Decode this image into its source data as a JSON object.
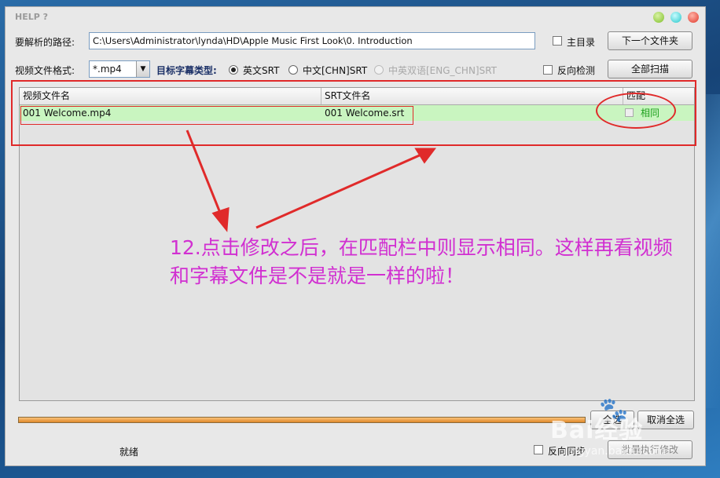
{
  "window": {
    "title": "HELP ?"
  },
  "path": {
    "label": "要解析的路径:",
    "value": "C:\\Users\\Administrator\\lynda\\HD\\Apple Music First Look\\0. Introduction"
  },
  "main_dir": {
    "label": "主目录"
  },
  "next_folder_button": "下一个文件夹",
  "format": {
    "label": "视频文件格式:",
    "value": "*.mp4"
  },
  "subtitle_type": {
    "label": "目标字幕类型:",
    "options": [
      {
        "label": "英文SRT",
        "selected": true,
        "enabled": true
      },
      {
        "label": "中文[CHN]SRT",
        "selected": false,
        "enabled": true
      },
      {
        "label": "中英双语[ENG_CHN]SRT",
        "selected": false,
        "enabled": false
      }
    ]
  },
  "reverse_detect": {
    "label": "反向检测"
  },
  "scan_all_button": "全部扫描",
  "table": {
    "columns": [
      "视频文件名",
      "SRT文件名",
      "匹配"
    ],
    "rows": [
      {
        "video": "001 Welcome.mp4",
        "srt": "001 Welcome.srt",
        "match": "相同"
      }
    ]
  },
  "annotation": {
    "line1": "12.点击修改之后，在匹配栏中则显示相同。这样再看视频",
    "line2": "和字幕文件是不是就是一样的啦！"
  },
  "select_all_button": "全选",
  "cancel_all_button": "取消全选",
  "status": "就绪",
  "reverse_sync": {
    "label": "反向同步"
  },
  "batch_modify_button": "批量执行修改",
  "watermark": {
    "brand": "Bai经验",
    "url": "jingyan.baidu.com"
  },
  "colors": {
    "row_match": "#c9f5c0",
    "annotation": "#d12fd1",
    "markup": "#e02a2a",
    "progress": "#f4a64a"
  }
}
